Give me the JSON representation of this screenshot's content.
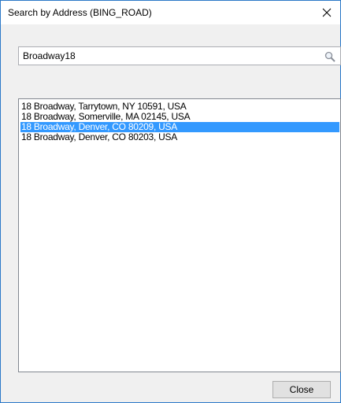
{
  "window": {
    "title": "Search by Address (BING_ROAD)",
    "close_icon": "close-icon",
    "border_color": "#2b79c8"
  },
  "search": {
    "value": "Broadway18",
    "icon": "search-icon"
  },
  "results": {
    "items": [
      {
        "label": "18 Broadway, Tarrytown, NY 10591, USA",
        "selected": false
      },
      {
        "label": "18 Broadway, Somerville, MA 02145, USA",
        "selected": false
      },
      {
        "label": "18 Broadway, Denver, CO 80209, USA",
        "selected": true
      },
      {
        "label": "18 Broadway, Denver, CO 80203, USA",
        "selected": false
      }
    ],
    "selection_color": "#3399ff"
  },
  "footer": {
    "close_label": "Close"
  }
}
